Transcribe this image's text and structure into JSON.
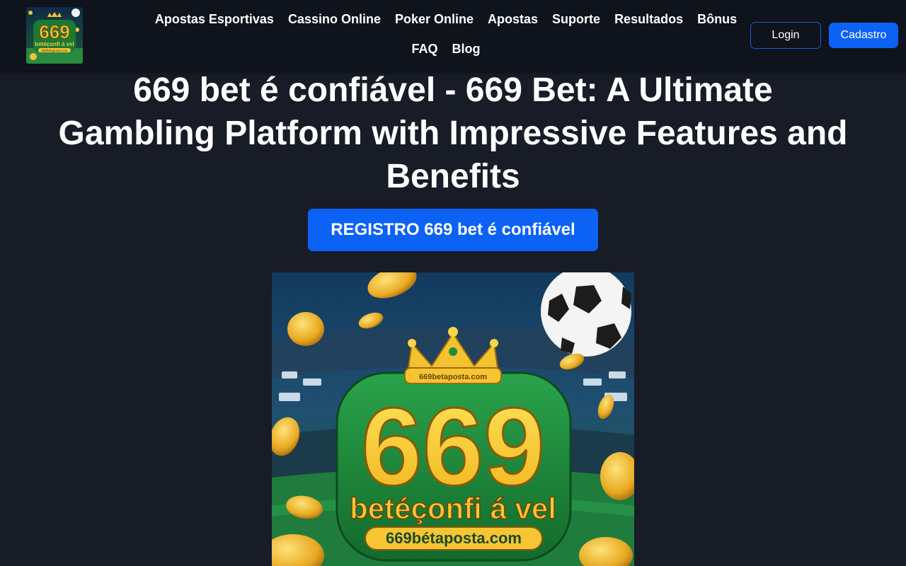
{
  "header": {
    "logo": {
      "number": "669",
      "word": "betéçonfi á vel",
      "url": "669bétaposta.com"
    },
    "nav": [
      "Apostas Esportivas",
      "Cassino Online",
      "Poker Online",
      "Apostas",
      "Suporte",
      "Resultados",
      "Bônus",
      "FAQ",
      "Blog"
    ],
    "login_label": "Login",
    "signup_label": "Cadastro"
  },
  "main": {
    "title": "669 bet é confiável - 669 Bet: A Ultimate Gambling Platform with Impressive Features and Benefits",
    "cta_label": "REGISTRO 669 bet é confiável",
    "hero": {
      "number": "669",
      "word": "betéçonfi á vel",
      "url": "669bétaposta.com",
      "crown_text": "669betaposta.com"
    }
  },
  "colors": {
    "background": "#171c27",
    "header": "#0e131c",
    "accent": "#0b62f5",
    "gold": "#f7c533",
    "green": "#1f8a3a"
  }
}
